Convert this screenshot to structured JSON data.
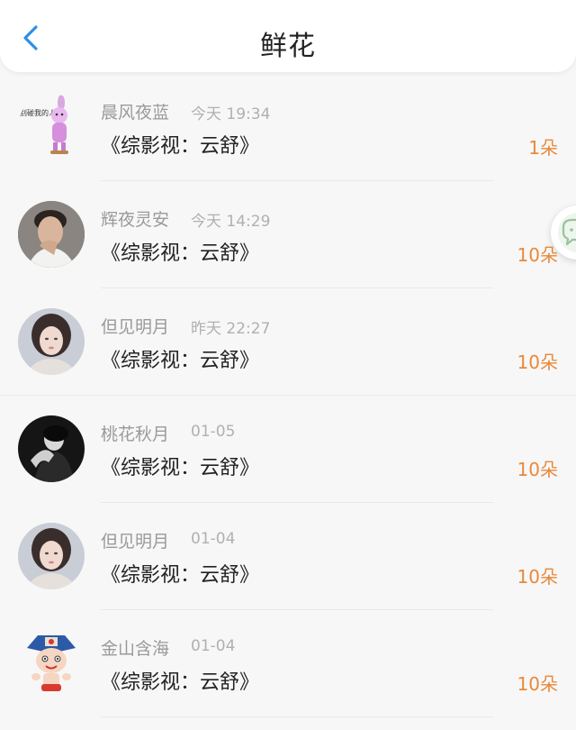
{
  "header": {
    "title": "鲜花",
    "back_icon": "chevron-left-icon",
    "accent_color": "#2f8fe6"
  },
  "float_button": {
    "icon": "chat-icon"
  },
  "flower_color": "#e8893a",
  "rows": [
    {
      "name": "晨风夜蓝",
      "time": "今天 19:34",
      "book": "《综影视：云舒》",
      "count": "1朵",
      "avatar": "cartoon-bunny-avatar",
      "avatar_text": "别碰我的人"
    },
    {
      "name": "辉夜灵安",
      "time": "今天 14:29",
      "book": "《综影视：云舒》",
      "count": "10朵",
      "avatar": "man-portrait-avatar"
    },
    {
      "name": "但见明月",
      "time": "昨天 22:27",
      "book": "《综影视：云舒》",
      "count": "10朵",
      "avatar": "woman-portrait-avatar"
    },
    {
      "name": "桃花秋月",
      "time": "01-05",
      "book": "《综影视：云舒》",
      "count": "10朵",
      "avatar": "dark-portrait-avatar"
    },
    {
      "name": "但见明月",
      "time": "01-04",
      "book": "《综影视：云舒》",
      "count": "10朵",
      "avatar": "woman-portrait-avatar"
    },
    {
      "name": "金山含海",
      "time": "01-04",
      "book": "《综影视：云舒》",
      "count": "10朵",
      "avatar": "cartoon-boy-avatar"
    }
  ]
}
